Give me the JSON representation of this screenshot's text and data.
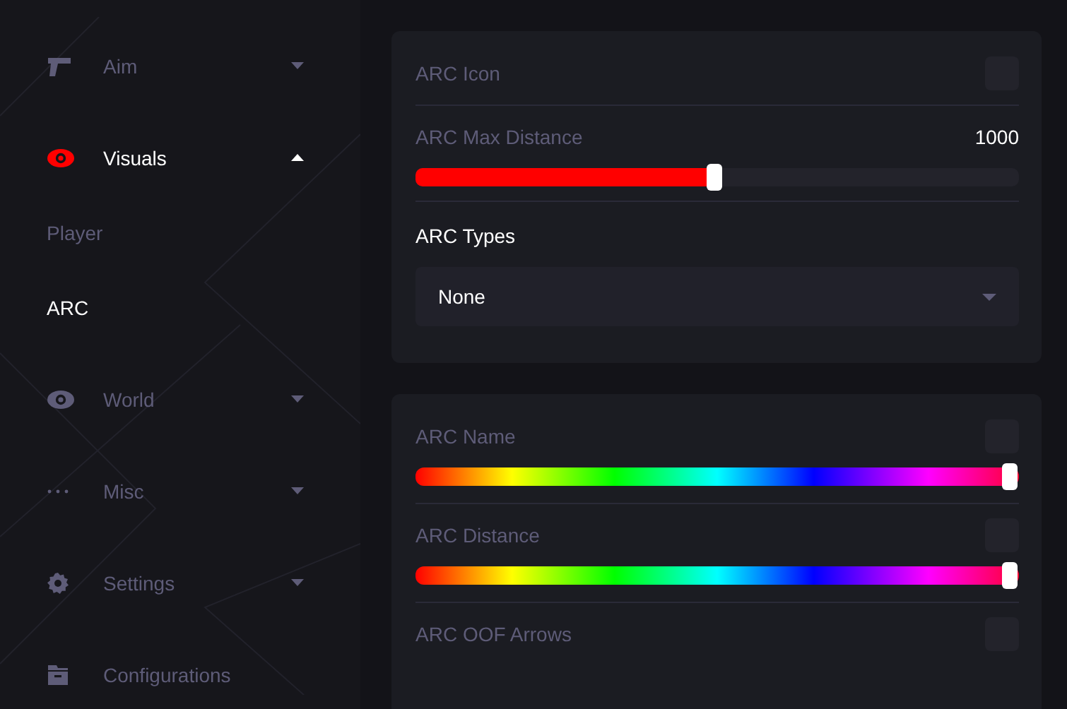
{
  "sidebar": {
    "items": [
      {
        "label": "Aim",
        "kind": "group",
        "selected": false,
        "expanded": false
      },
      {
        "label": "Visuals",
        "kind": "group",
        "selected": true,
        "expanded": true,
        "children": [
          {
            "label": "Player",
            "selected": false
          },
          {
            "label": "ARC",
            "selected": true
          }
        ]
      },
      {
        "label": "World",
        "kind": "group",
        "selected": false,
        "expanded": false
      },
      {
        "label": "Misc",
        "kind": "group",
        "selected": false,
        "expanded": false
      },
      {
        "label": "Settings",
        "kind": "group",
        "selected": false,
        "expanded": false
      },
      {
        "label": "Configurations",
        "kind": "link",
        "selected": false
      }
    ]
  },
  "cards": [
    {
      "rows": [
        {
          "kind": "toggle",
          "label": "ARC Icon",
          "checked": false
        },
        {
          "kind": "slider",
          "label": "ARC Max Distance",
          "value": "1000",
          "level": 0.5
        },
        {
          "kind": "dropdown",
          "label": "ARC Types",
          "value": "None"
        }
      ]
    },
    {
      "rows": [
        {
          "kind": "color",
          "label": "ARC Name",
          "checked": false,
          "level": 1
        },
        {
          "kind": "color",
          "label": "ARC Distance",
          "checked": false,
          "level": 1
        },
        {
          "kind": "toggle",
          "label": "ARC OOF Arrows",
          "checked": false
        }
      ]
    }
  ]
}
